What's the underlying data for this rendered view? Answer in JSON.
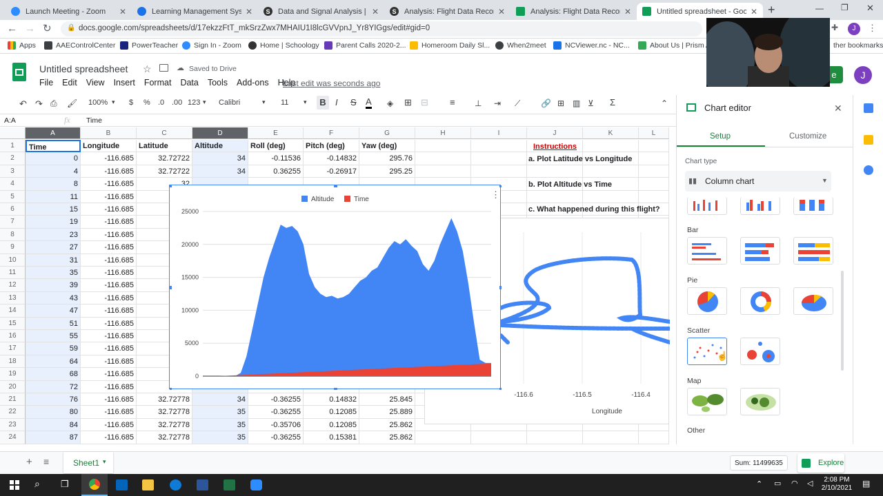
{
  "browser": {
    "tabs": [
      {
        "label": "Launch Meeting - Zoom",
        "color": "#2d8cff"
      },
      {
        "label": "Learning Management System",
        "color": "#1a73e8"
      },
      {
        "label": "Data and Signal Analysis | Scho",
        "color": "#333333"
      },
      {
        "label": "Analysis: Flight Data Recorder",
        "color": "#333333"
      },
      {
        "label": "Analysis: Flight Data Recorder",
        "color": "#0f9d58"
      },
      {
        "label": "Untitled spreadsheet - Google",
        "color": "#0f9d58"
      }
    ],
    "new_tab": "+",
    "url": "docs.google.com/spreadsheets/d/17ekzzFtT_mkSrzZwx7MHAIU1I8lcGVVpnJ_Yr8YIGgs/edit#gid=0",
    "bookmarks": [
      "Apps",
      "AAEControlCenter",
      "PowerTeacher",
      "Sign In - Zoom",
      "Home | Schoology",
      "Parent Calls 2020-2...",
      "Homeroom Daily Sl...",
      "When2meet",
      "NCViewer.nc - NC...",
      "About Us | Prism A..."
    ],
    "other_bookmarks": "ther bookmarks",
    "profile_initial": "J"
  },
  "sheets": {
    "title": "Untitled spreadsheet",
    "saved": "Saved to Drive",
    "menu": [
      "File",
      "Edit",
      "View",
      "Insert",
      "Format",
      "Data",
      "Tools",
      "Add-ons",
      "Help"
    ],
    "last_edit": "Last edit was seconds ago",
    "toolbar": {
      "zoom": "100%",
      "currency": "$",
      "percent": "%",
      "dec_less": ".0",
      "dec_more": ".00",
      "format": "123",
      "font": "Calibri",
      "size": "11"
    },
    "name_box": "A:A",
    "fx": "fx",
    "formula": "Time",
    "share_label": "e",
    "user_initial": "J"
  },
  "grid": {
    "columns": [
      "A",
      "B",
      "C",
      "D",
      "E",
      "F",
      "G",
      "H",
      "I",
      "J",
      "K",
      "L"
    ],
    "headers": [
      "Time",
      "Longitude",
      "Latitude",
      "Altitude",
      "Roll (deg)",
      "Pitch (deg)",
      "Yaw (deg)"
    ],
    "rows": [
      [
        "0",
        "-116.685",
        "32.72722",
        "34",
        "-0.11536",
        "-0.14832",
        "295.76"
      ],
      [
        "4",
        "-116.685",
        "32.72722",
        "34",
        "0.36255",
        "-0.26917",
        "295.25"
      ],
      [
        "8",
        "-116.685",
        "32",
        "",
        "",
        "",
        ""
      ],
      [
        "11",
        "-116.685",
        "32",
        "",
        "",
        "",
        ""
      ],
      [
        "15",
        "-116.685",
        "32",
        "",
        "",
        "",
        ""
      ],
      [
        "19",
        "-116.685",
        "32",
        "",
        "",
        "",
        ""
      ],
      [
        "23",
        "-116.685",
        "3",
        "",
        "",
        "",
        ""
      ],
      [
        "27",
        "-116.685",
        "3",
        "",
        "",
        "",
        ""
      ],
      [
        "31",
        "-116.685",
        "3",
        "",
        "",
        "",
        ""
      ],
      [
        "35",
        "-116.685",
        "32",
        "",
        "",
        "",
        ""
      ],
      [
        "39",
        "-116.685",
        "32",
        "",
        "",
        "",
        ""
      ],
      [
        "43",
        "-116.685",
        "32",
        "",
        "",
        "",
        ""
      ],
      [
        "47",
        "-116.685",
        "32",
        "",
        "",
        "",
        ""
      ],
      [
        "51",
        "-116.685",
        "32",
        "",
        "",
        "",
        ""
      ],
      [
        "55",
        "-116.685",
        "32",
        "",
        "",
        "",
        ""
      ],
      [
        "59",
        "-116.685",
        "32",
        "",
        "",
        "",
        ""
      ],
      [
        "64",
        "-116.685",
        "32",
        "",
        "",
        "",
        ""
      ],
      [
        "68",
        "-116.685",
        "32",
        "",
        "",
        "",
        ""
      ],
      [
        "72",
        "-116.685",
        "32",
        "",
        "",
        "",
        ""
      ],
      [
        "76",
        "-116.685",
        "32.72778",
        "34",
        "-0.36255",
        "0.14832",
        "25.845"
      ],
      [
        "80",
        "-116.685",
        "32.72778",
        "35",
        "-0.36255",
        "0.12085",
        "25.889"
      ],
      [
        "84",
        "-116.685",
        "32.72778",
        "35",
        "-0.35706",
        "0.12085",
        "25.862"
      ],
      [
        "87",
        "-116.685",
        "32.72778",
        "35",
        "-0.36255",
        "0.15381",
        "25.862"
      ]
    ],
    "instructions": {
      "title": "Instructions",
      "a": "a. Plot Latitude vs Longitude",
      "b": "b. Plot Altitude vs Time",
      "c": "c. What happened during this flight?"
    },
    "bg_chart": {
      "ticks": [
        "-116.6",
        "-116.5",
        "-116.4"
      ],
      "xlabel": "Longitude"
    }
  },
  "chart_data": {
    "type": "area",
    "legend": [
      "Altitude",
      "Time"
    ],
    "legend_position": "top",
    "colors": {
      "Altitude": "#4285f4",
      "Time": "#ea4335"
    },
    "y_ticks": [
      0,
      5000,
      10000,
      15000,
      20000,
      25000
    ],
    "ylim": [
      0,
      25000
    ],
    "series": [
      {
        "name": "Altitude",
        "values": [
          0,
          0,
          0,
          0,
          500,
          3000,
          7000,
          11000,
          15000,
          18000,
          20500,
          23000,
          22500,
          22800,
          22000,
          20000,
          15500,
          13500,
          12500,
          12000,
          12200,
          11800,
          12000,
          12500,
          13500,
          14500,
          15000,
          16000,
          16500,
          18000,
          19500,
          20500,
          20000,
          20800,
          19800,
          19000,
          17000,
          16000,
          17500,
          20000,
          22000,
          24000,
          22000,
          19000,
          14000,
          8000,
          2500,
          2000,
          2000
        ]
      },
      {
        "name": "Time",
        "values": [
          0,
          40,
          80,
          120,
          160,
          200,
          240,
          280,
          320,
          360,
          400,
          440,
          480,
          520,
          560,
          600,
          640,
          680,
          720,
          760,
          800,
          840,
          880,
          920,
          960,
          1000,
          1040,
          1080,
          1120,
          1160,
          1200,
          1240,
          1280,
          1320,
          1360,
          1400,
          1440,
          1480,
          1520,
          1560,
          1600,
          1640,
          1680,
          1720,
          1760,
          1800,
          1840,
          1880,
          1920
        ]
      }
    ]
  },
  "editor": {
    "title": "Chart editor",
    "tabs": [
      "Setup",
      "Customize"
    ],
    "chart_type_label": "Chart type",
    "chart_type": "Column chart",
    "sections": [
      "Bar",
      "Pie",
      "Scatter",
      "Map",
      "Other"
    ]
  },
  "bottom": {
    "sheet_tab": "Sheet1",
    "sum": "Sum: 11499635",
    "explore": "Explore"
  },
  "taskbar": {
    "time": "2:08 PM",
    "date": "2/10/2021"
  }
}
